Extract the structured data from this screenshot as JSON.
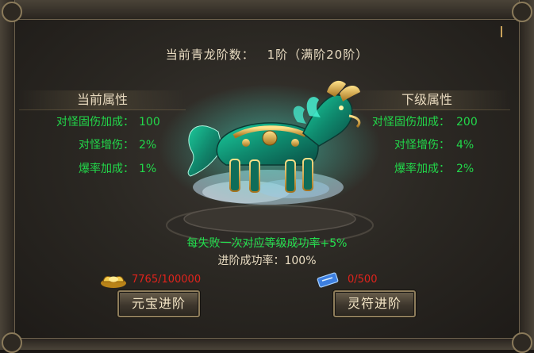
{
  "header": {
    "rank_label": "当前青龙阶数：",
    "rank_value": "1阶（满阶20阶）"
  },
  "current_attributes": {
    "title": "当前属性",
    "rows": [
      {
        "label": "对怪固伤加成：",
        "value": "100"
      },
      {
        "label": "对怪增伤：",
        "value": "2%"
      },
      {
        "label": "爆率加成：",
        "value": "1%"
      }
    ]
  },
  "next_attributes": {
    "title": "下级属性",
    "rows": [
      {
        "label": "对怪固伤加成：",
        "value": "200"
      },
      {
        "label": "对怪增伤：",
        "value": "4%"
      },
      {
        "label": "爆率加成：",
        "value": "2%"
      }
    ]
  },
  "upgrade": {
    "fail_bonus_tip": "每失败一次对应等级成功率+5%",
    "success_rate_text": "进阶成功率：100%"
  },
  "costs": {
    "ingot": {
      "icon": "gold-ingot-icon",
      "amount": "7765/100000",
      "color": "#e0231c"
    },
    "talisman": {
      "icon": "talisman-icon",
      "amount": "0/500",
      "color": "#e0231c"
    }
  },
  "buttons": {
    "ingot_advance": "元宝进阶",
    "talisman_advance": "灵符进阶"
  },
  "colors": {
    "accent_green": "#22d84a",
    "label_cream": "#e9dcc2",
    "cost_red": "#e0231c",
    "button_border": "#8e7d5b"
  }
}
